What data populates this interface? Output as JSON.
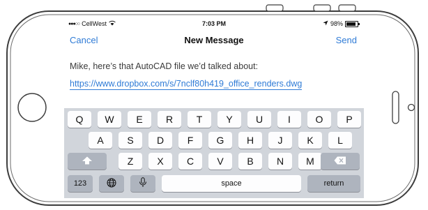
{
  "status": {
    "carrier": "CellWest",
    "signal_icon": "signal-dots-icon",
    "wifi_icon": "wifi-icon",
    "time": "7:03 PM",
    "location_icon": "location-arrow-icon",
    "battery": "98%",
    "battery_icon": "battery-icon"
  },
  "nav": {
    "cancel_label": "Cancel",
    "title": "New Message",
    "send_label": "Send"
  },
  "message": {
    "text": "Mike, here’s that AutoCAD file we’d talked about:",
    "link": "https://www.dropbox.com/s/7nclf80h419_office_renders.dwg"
  },
  "keyboard": {
    "row1": [
      "Q",
      "W",
      "E",
      "R",
      "T",
      "Y",
      "U",
      "I",
      "O",
      "P"
    ],
    "row2": [
      "A",
      "S",
      "D",
      "F",
      "G",
      "H",
      "J",
      "K",
      "L"
    ],
    "row3": [
      "Z",
      "X",
      "C",
      "V",
      "B",
      "N",
      "M"
    ],
    "shift_icon": "shift-arrow-icon",
    "delete_icon": "delete-backspace-icon",
    "numbers_label": "123",
    "globe_icon": "globe-icon",
    "mic_icon": "microphone-icon",
    "space_label": "space",
    "return_label": "return"
  },
  "colors": {
    "accent": "#2f7bd6",
    "keyboard_bg": "#d1d5db",
    "key_bg": "#fdfdfe",
    "dark_key_bg": "#aeb4be"
  }
}
